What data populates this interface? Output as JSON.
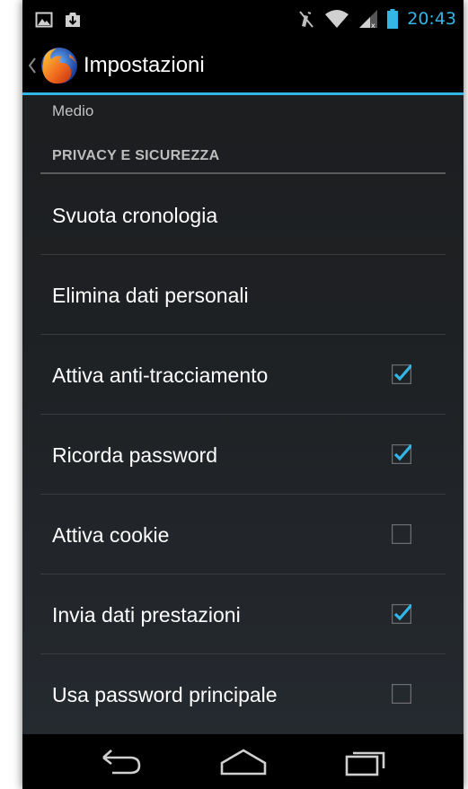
{
  "status_bar": {
    "time": "20:43",
    "left_icons": [
      "picture-icon",
      "download-icon"
    ],
    "right_icons": [
      "mute-icon",
      "wifi-icon",
      "signal-icon",
      "battery-icon"
    ]
  },
  "action_bar": {
    "title": "Impostazioni",
    "logo": "firefox-logo"
  },
  "content": {
    "previous_summary": "Medio",
    "section_header": "PRIVACY E SICUREZZA",
    "items": [
      {
        "label": "Svuota cronologia",
        "has_checkbox": false,
        "checked": false
      },
      {
        "label": "Elimina dati personali",
        "has_checkbox": false,
        "checked": false
      },
      {
        "label": "Attiva anti-tracciamento",
        "has_checkbox": true,
        "checked": true
      },
      {
        "label": "Ricorda password",
        "has_checkbox": true,
        "checked": true
      },
      {
        "label": "Attiva cookie",
        "has_checkbox": true,
        "checked": false
      },
      {
        "label": "Invia dati prestazioni",
        "has_checkbox": true,
        "checked": true
      },
      {
        "label": "Usa password principale",
        "has_checkbox": true,
        "checked": false
      }
    ]
  },
  "nav_bar": {
    "buttons": [
      "back-icon",
      "home-icon",
      "recent-apps-icon"
    ]
  },
  "colors": {
    "accent": "#33b5e5",
    "background_top": "#1b1c1e",
    "background_bottom": "#262b31",
    "bar": "#000000"
  }
}
